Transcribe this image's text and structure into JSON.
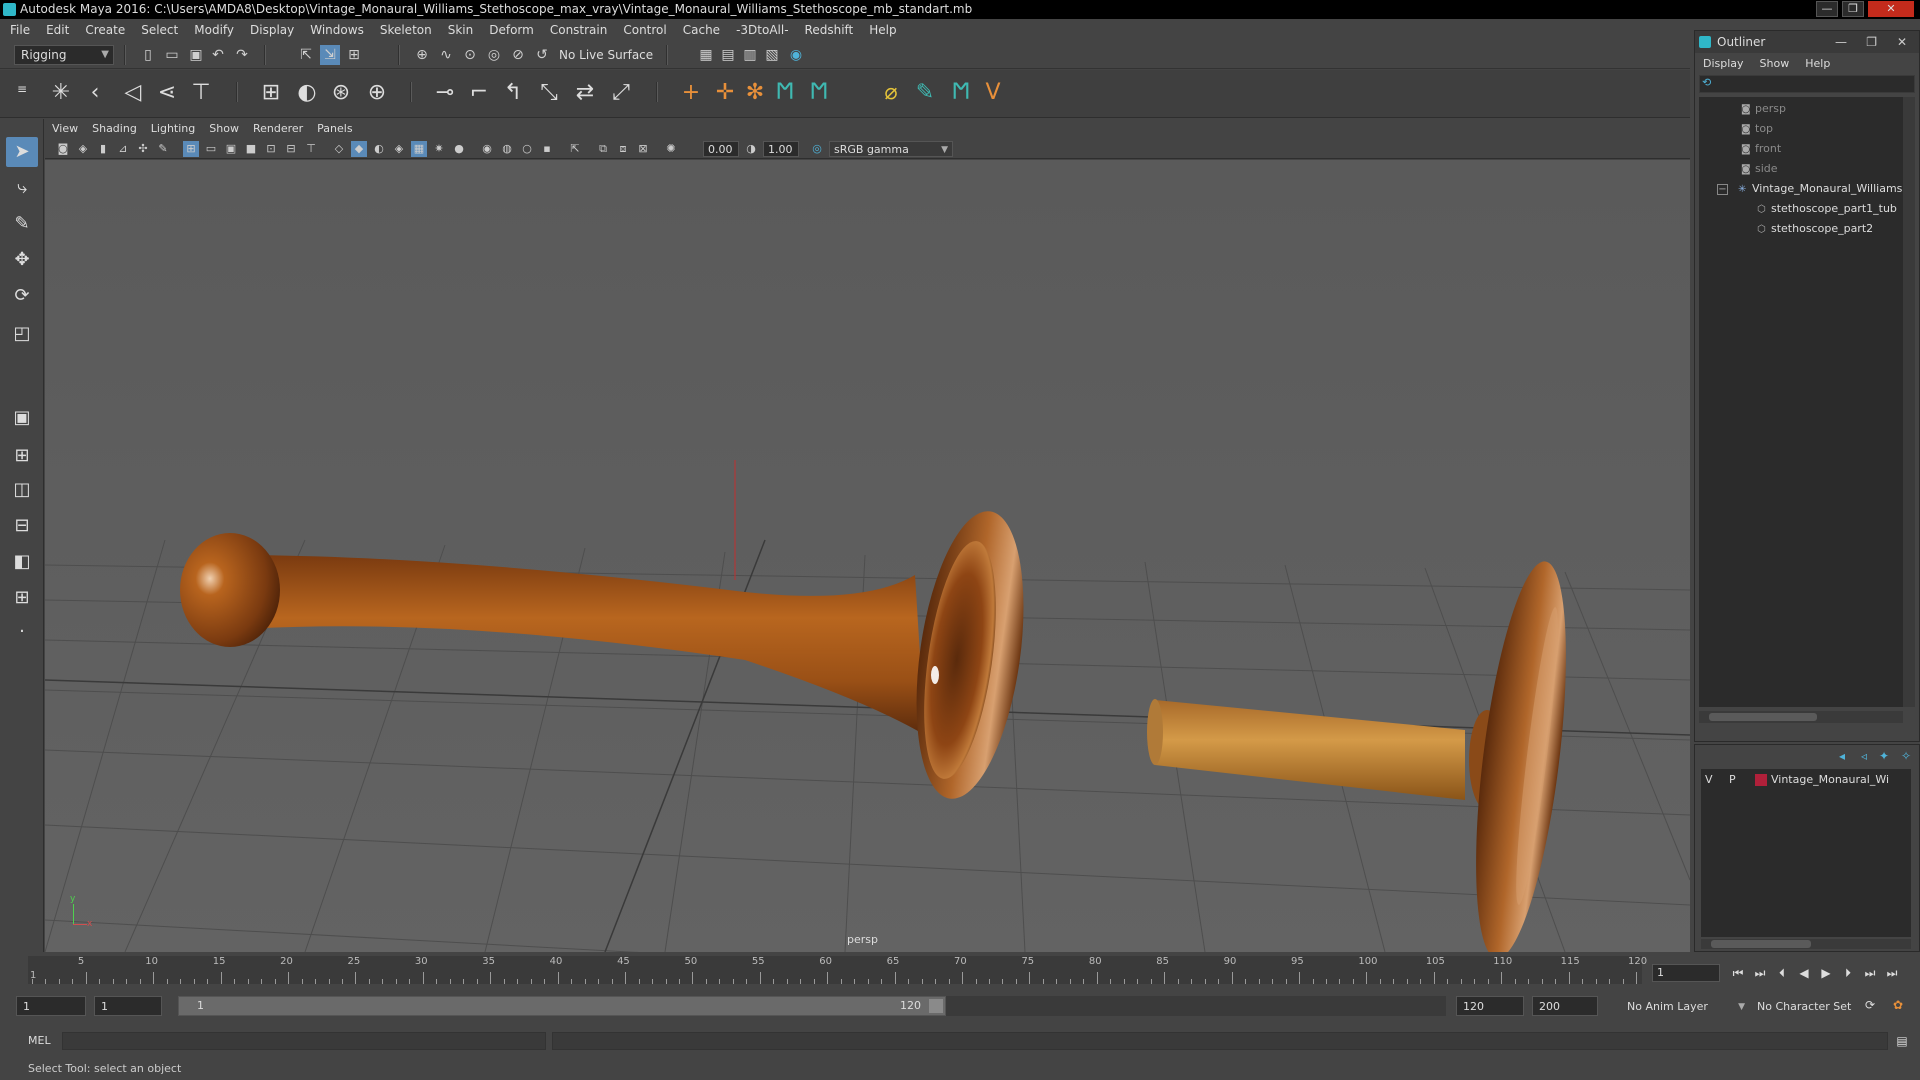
{
  "window": {
    "title": "Autodesk Maya 2016: C:\\Users\\AMDA8\\Desktop\\Vintage_Monaural_Williams_Stethoscope_max_vray\\Vintage_Monaural_Williams_Stethoscope_mb_standart.mb",
    "minimize_glyph": "—",
    "restore_glyph": "❐",
    "close_glyph": "✕"
  },
  "main_menu": [
    "File",
    "Edit",
    "Create",
    "Select",
    "Modify",
    "Display",
    "Windows",
    "Skeleton",
    "Skin",
    "Deform",
    "Constrain",
    "Control",
    "Cache",
    "-3DtoAll-",
    "Redshift",
    "Help"
  ],
  "status_line": {
    "menu_set": "Rigging",
    "live_surface": "No Live Surface"
  },
  "panel_menu": [
    "View",
    "Shading",
    "Lighting",
    "Show",
    "Renderer",
    "Panels"
  ],
  "panel_toolbar": {
    "exposure": "0.00",
    "gamma": "1.00",
    "color_space": "sRGB gamma"
  },
  "viewport": {
    "camera_label": "persp",
    "axis_y": "y",
    "axis_x": "x"
  },
  "outliner": {
    "title": "Outliner",
    "menu": [
      "Display",
      "Show",
      "Help"
    ],
    "items": [
      {
        "label": "persp",
        "dim": true
      },
      {
        "label": "top",
        "dim": true
      },
      {
        "label": "front",
        "dim": true
      },
      {
        "label": "side",
        "dim": true
      },
      {
        "label": "Vintage_Monaural_Williams",
        "dim": false
      },
      {
        "label": "stethoscope_part1_tub",
        "dim": false
      },
      {
        "label": "stethoscope_part2",
        "dim": false
      }
    ]
  },
  "layers": {
    "visible_flag": "V",
    "playback_flag": "P",
    "layer_name": "Vintage_Monaural_Wi",
    "layer_color": "#b0203a"
  },
  "time_slider": {
    "ticks": [
      "5",
      "10",
      "15",
      "20",
      "25",
      "30",
      "35",
      "40",
      "45",
      "50",
      "55",
      "60",
      "65",
      "70",
      "75",
      "80",
      "85",
      "90",
      "95",
      "100",
      "105",
      "110",
      "115",
      "120"
    ],
    "current_frame_marker": "1",
    "current_frame": "1"
  },
  "range_slider": {
    "start": "1",
    "playback_start": "1",
    "range_start_label": "1",
    "range_end_label": "120",
    "playback_end": "120",
    "end": "200",
    "anim_layer": "No Anim Layer",
    "character_set": "No Character Set"
  },
  "command_line": {
    "language": "MEL"
  },
  "help_line": "Select Tool: select an object",
  "colors": {
    "viewport_bg": "#5d5d5d",
    "wood_dark": "#5a2a0c",
    "wood_mid": "#a0581b",
    "wood_light": "#c98a3a",
    "accent": "#5a8ab8"
  }
}
